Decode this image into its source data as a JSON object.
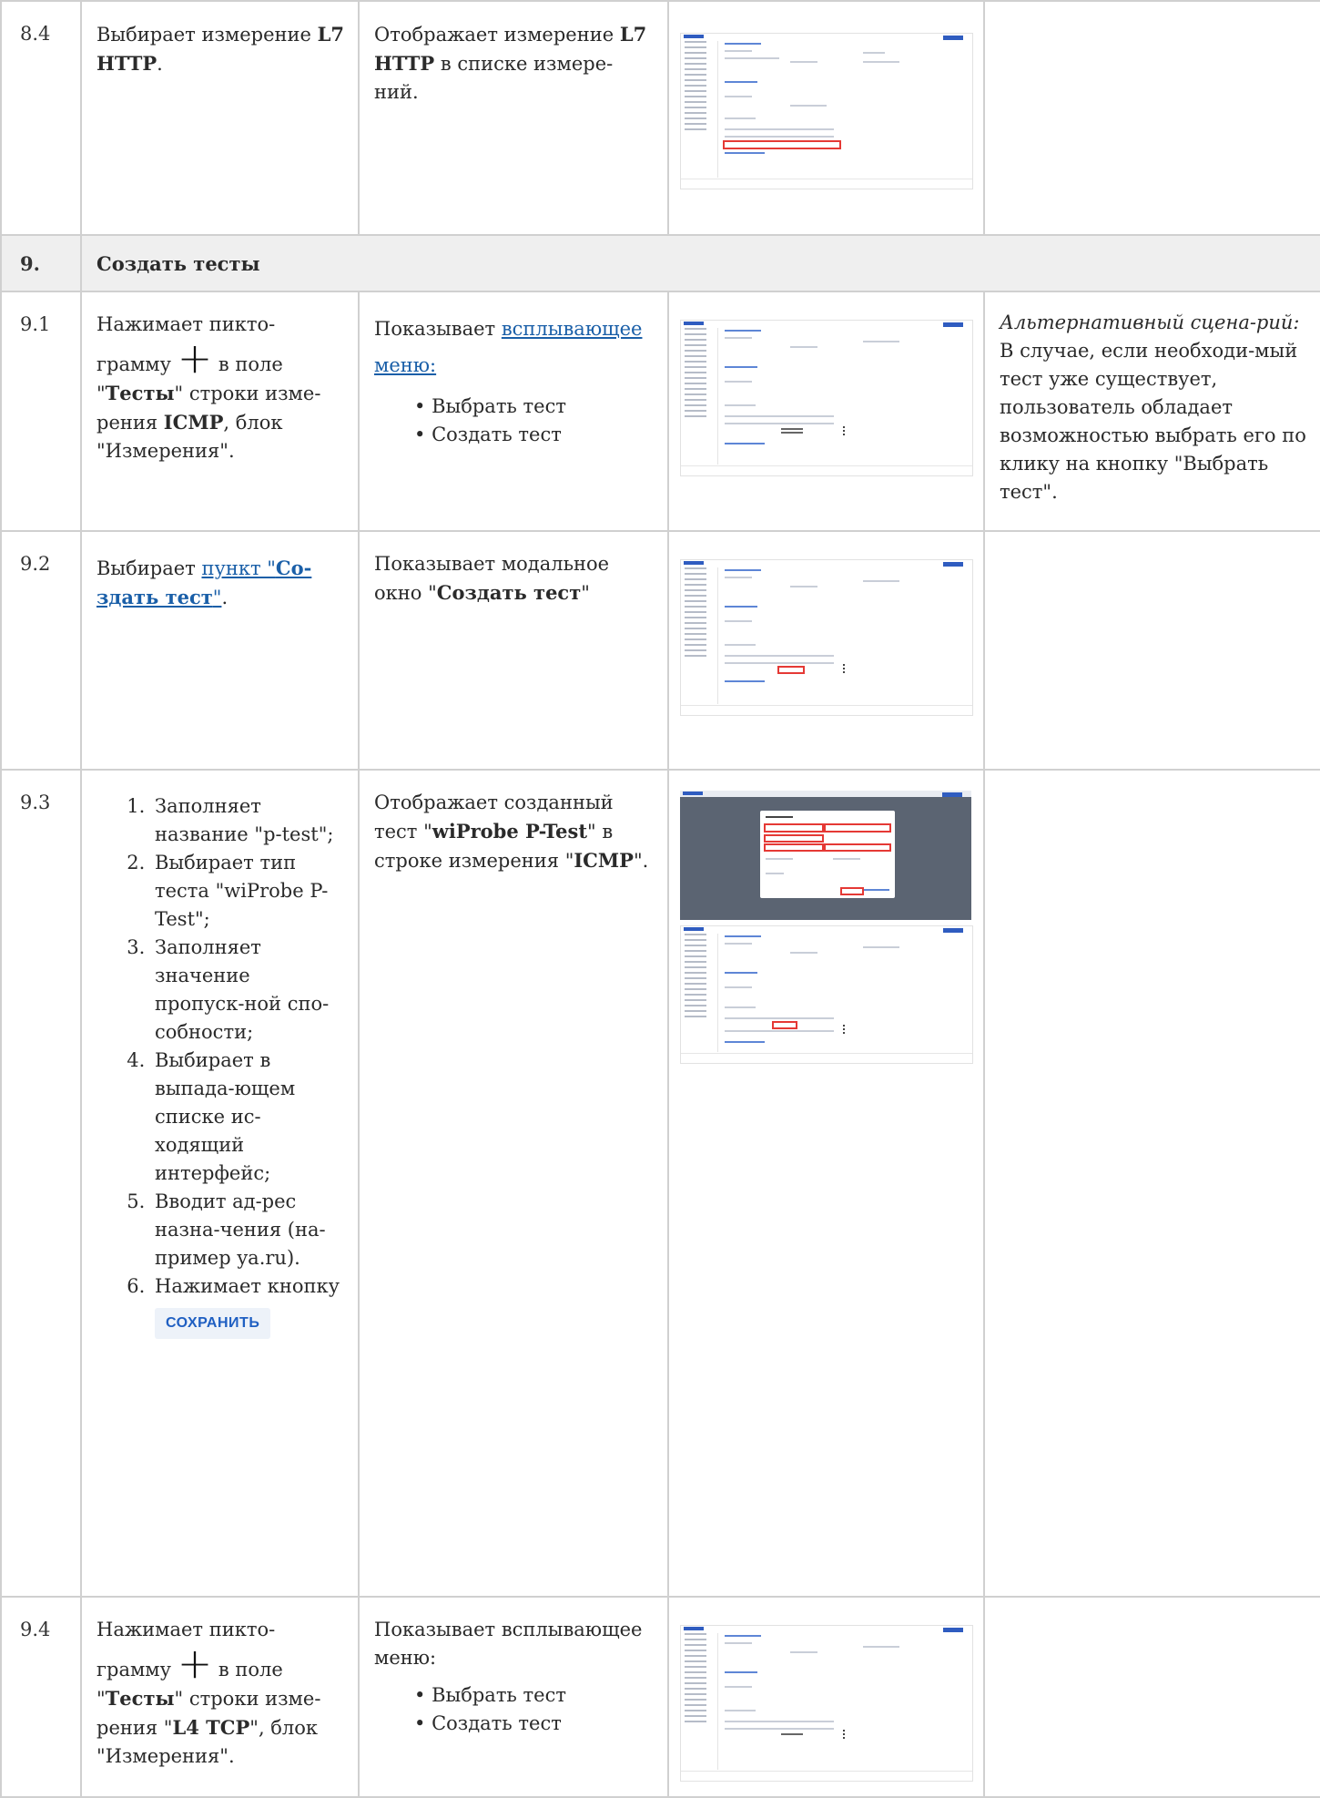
{
  "rows": {
    "r84": {
      "num": "8.4",
      "action_pre": "Выбирает измерение ",
      "action_bold": "L7 HTTP",
      "action_post": ".",
      "result_pre": "Отображает измерение ",
      "result_bold": "L7 HTTP",
      "result_post": " в списке измере-ний."
    },
    "sec9": {
      "num": "9.",
      "title": "Создать тесты"
    },
    "r91": {
      "num": "9.1",
      "action_a": "Нажимает пикто-",
      "action_b": "грамму",
      "action_c": " в поле",
      "action_q1": "\"",
      "action_bold1": "Тесты",
      "action_d": "\" строки изме-рения ",
      "action_bold2": "ICMP",
      "action_e": ", блок \"Измерения\".",
      "result_pre": "Показывает ",
      "result_link": "всплывающее меню:",
      "menu": [
        "Выбрать тест",
        "Создать тест"
      ],
      "note_title": "Альтернативный сцена-рий:",
      "note_body": "В случае, если необходи-мый тест уже существует, пользователь обладает возможностью выбрать его по клику на кнопку \"Выбрать тест\"."
    },
    "r92": {
      "num": "9.2",
      "action_pre": "Выбирает ",
      "action_link_a": "пункт \"",
      "action_link_bold": "Со-здать тест",
      "action_link_b": "\"",
      "action_post": ".",
      "result_pre": "Показывает модальное окно \"",
      "result_bold": "Создать тест",
      "result_post": "\""
    },
    "r93": {
      "num": "9.3",
      "steps": [
        "Заполняет название \"p-test\";",
        "Выбирает тип теста \"wiProbe P-Test\";",
        "Заполняет значение пропуск-ной спо-собности;",
        "Выбирает в выпада-ющем списке ис-ходящий интерфейс;",
        "Вводит ад-рес назна-чения (на-пример ya.ru).",
        "Нажимает кнопку"
      ],
      "save_button": "СОХРАНИТЬ",
      "result_pre": "Отображает созданный тест \"",
      "result_bold1": "wiProbe P-Test",
      "result_mid": "\" в строке измерения \"",
      "result_bold2": "ICMP",
      "result_post": "\"."
    },
    "r94": {
      "num": "9.4",
      "action_a": "Нажимает пикто-",
      "action_b": "грамму",
      "action_c": " в поле",
      "action_q1": "\"",
      "action_bold1": "Тесты",
      "action_d": "\" строки изме-рения \"",
      "action_bold2": "L4 TCP",
      "action_e": "\", блок \"Измерения\".",
      "result_text": "Показывает всплывающее меню:",
      "menu": [
        "Выбрать тест",
        "Создать тест"
      ]
    }
  },
  "icons": {
    "plus": "plus-icon"
  }
}
